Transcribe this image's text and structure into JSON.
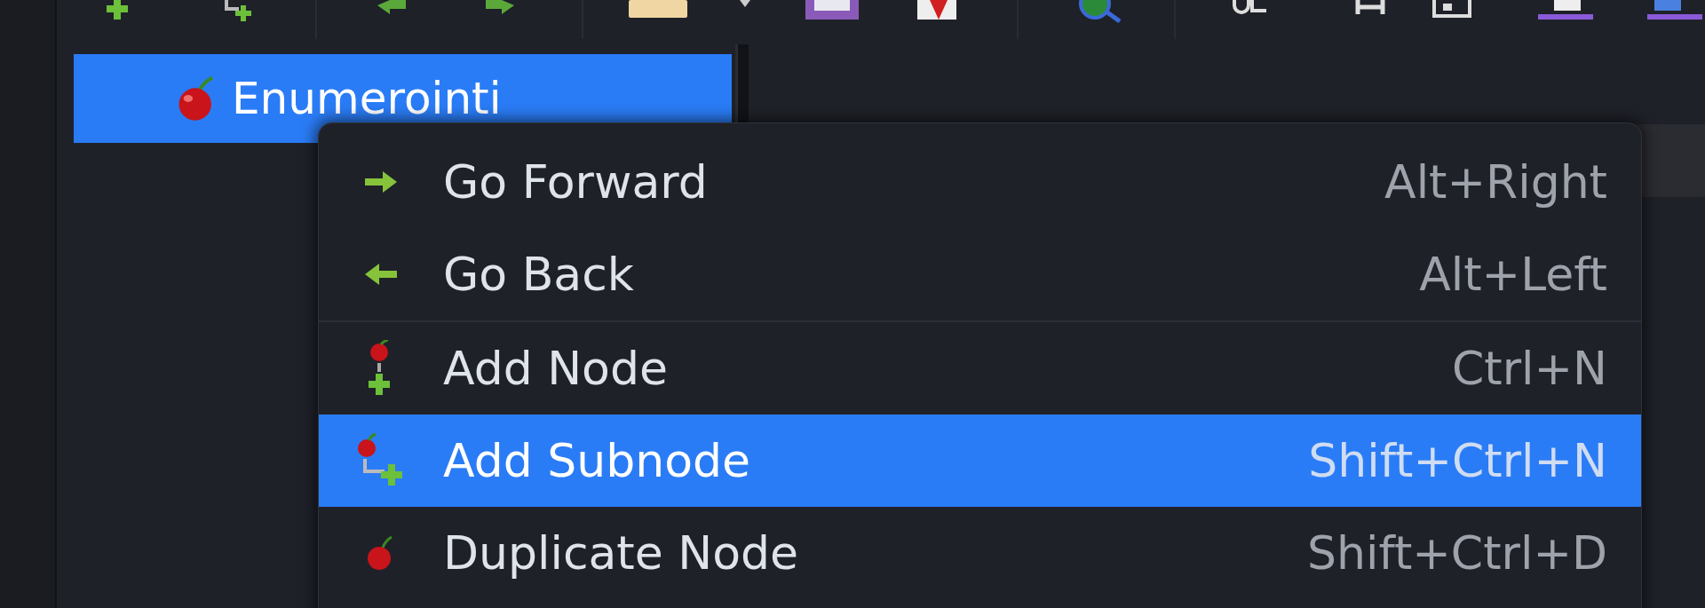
{
  "tree": {
    "items": [
      {
        "label": "Enumerointi",
        "selected": true
      }
    ]
  },
  "context_menu": {
    "items": [
      {
        "kind": "item",
        "label": "Go Forward",
        "shortcut": "Alt+Right",
        "selected": false
      },
      {
        "kind": "item",
        "label": "Go Back",
        "shortcut": "Alt+Left",
        "selected": false
      },
      {
        "kind": "separator"
      },
      {
        "kind": "item",
        "label": "Add Node",
        "shortcut": "Ctrl+N",
        "selected": false
      },
      {
        "kind": "item",
        "label": "Add Subnode",
        "shortcut": "Shift+Ctrl+N",
        "selected": true
      },
      {
        "kind": "item",
        "label": "Duplicate Node",
        "shortcut": "Shift+Ctrl+D",
        "selected": false
      }
    ]
  }
}
